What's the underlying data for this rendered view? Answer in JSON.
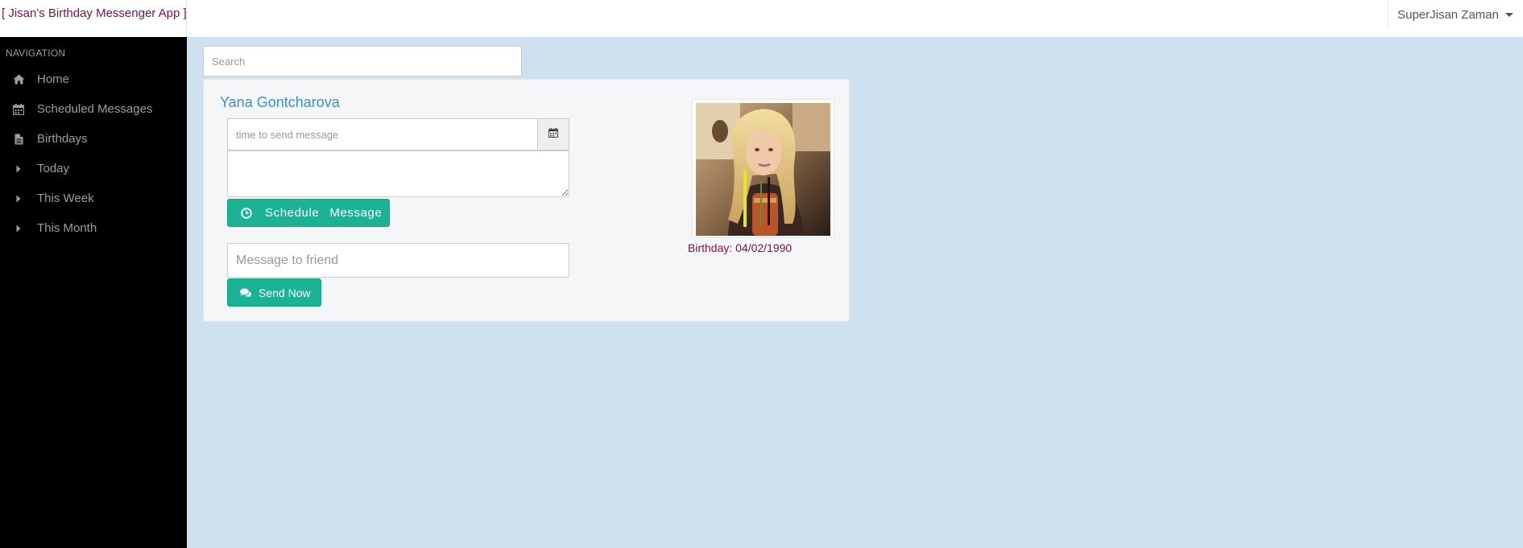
{
  "app": {
    "brand": "[ Jisan's Birthday Messenger App ]",
    "user_name": "SuperJisan Zaman"
  },
  "sidebar": {
    "header": "NAVIGATION",
    "items": [
      {
        "label": "Home",
        "icon": "home-icon"
      },
      {
        "label": "Scheduled Messages",
        "icon": "calendar-icon"
      },
      {
        "label": "Birthdays",
        "icon": "file-icon"
      },
      {
        "label": "Today",
        "icon": "caret-right-icon"
      },
      {
        "label": "This Week",
        "icon": "caret-right-icon"
      },
      {
        "label": "This Month",
        "icon": "caret-right-icon"
      }
    ]
  },
  "search": {
    "placeholder": "Search",
    "value": ""
  },
  "friend": {
    "name": "Yana Gontcharova",
    "birthday": "Birthday: 04/02/1990"
  },
  "schedule": {
    "time_placeholder": "time to send message",
    "message_value": "",
    "button_word1": "Schedule",
    "button_word2": "Message"
  },
  "send": {
    "placeholder": "Message to friend",
    "button_label": "Send Now"
  },
  "colors": {
    "accent": "#1ab394",
    "brand": "#7b1346",
    "link": "#3a8fcf",
    "sidebar_bg": "#000000",
    "page_bg": "#cfe0f1"
  }
}
